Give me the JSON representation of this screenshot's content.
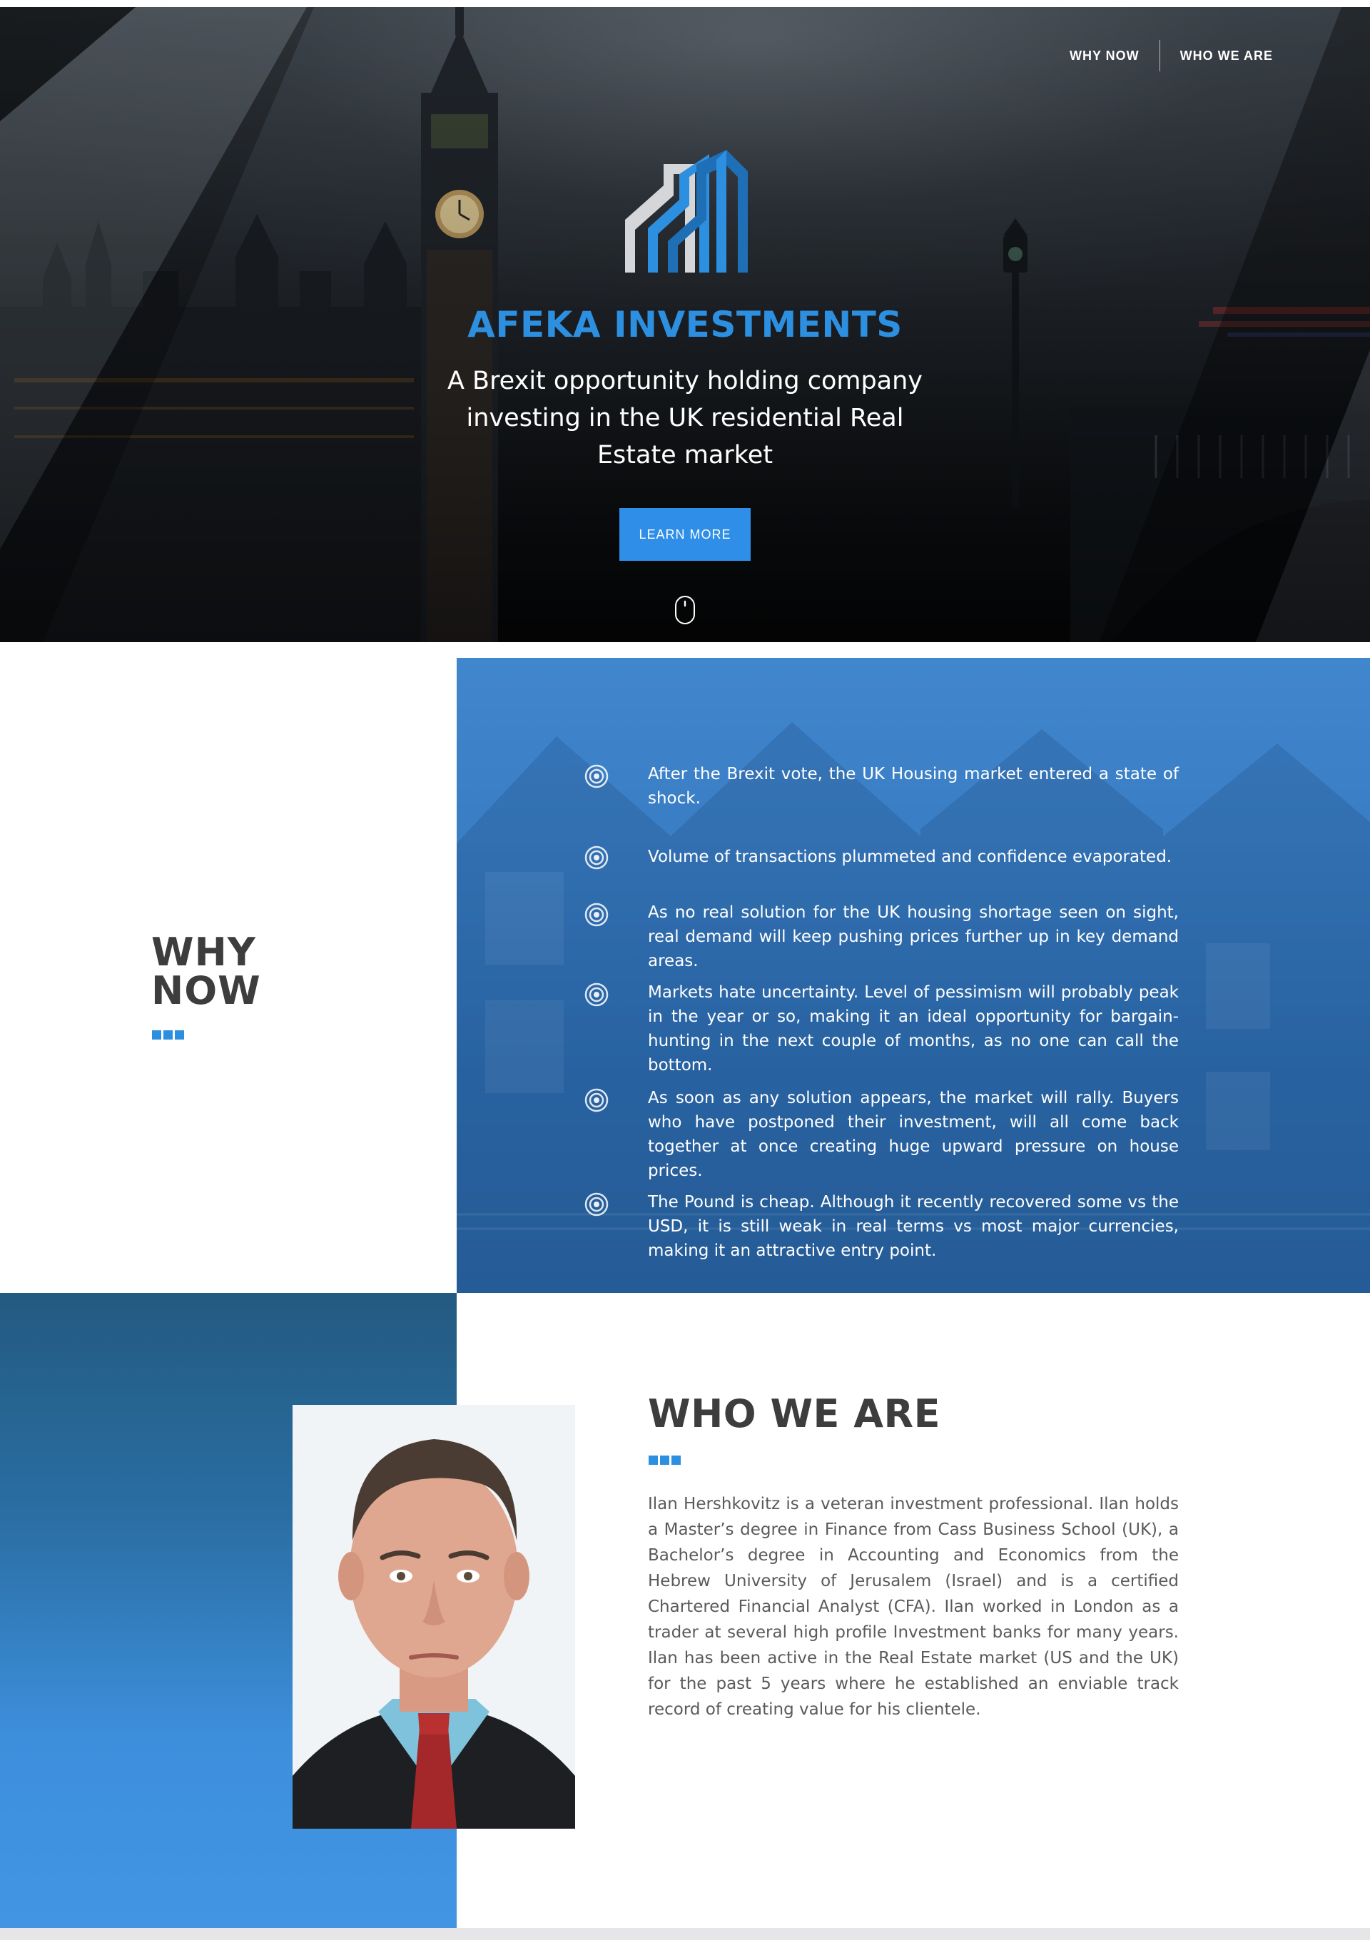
{
  "colors": {
    "accent_blue": "#2d8fe0",
    "button_blue": "#2e8ee8",
    "heading_dark": "#3d3d3d",
    "body_gray": "#5a5a5a",
    "why_panel_blue": "#3f86cc",
    "who_panel_blue": "#4195e3"
  },
  "nav": {
    "items": [
      {
        "label": "WHY NOW"
      },
      {
        "label": "WHO WE ARE"
      }
    ]
  },
  "hero": {
    "logo_icon": "building-bars-logo",
    "title": "AFEKA INVESTMENTS",
    "tagline": "A Brexit opportunity holding company investing in the UK residential Real Estate market",
    "cta_label": "LEARN MORE",
    "scroll_icon": "mouse-scroll-icon"
  },
  "why_now": {
    "title_line1": "WHY",
    "title_line2": "NOW",
    "bullet_icon": "target-icon",
    "items": [
      {
        "text": "After the Brexit vote, the UK Housing market entered a state of shock."
      },
      {
        "text": "Volume of transactions plummeted and confidence evaporated."
      },
      {
        "text": "As no real solution for the UK housing shortage seen on sight, real demand will keep pushing prices further up in key demand areas."
      },
      {
        "text": "Markets hate uncertainty. Level of pessimism will probably peak in the year or so, making it an ideal opportunity for bargain-hunting in the next couple of months, as no one can call the bottom."
      },
      {
        "text": "As soon as any solution appears, the market will rally. Buyers who have postponed their investment, will all come back together at once creating huge upward pressure on house prices."
      },
      {
        "text": "The Pound is cheap. Although it recently recovered some vs the USD, it is still weak in real terms vs most major currencies, making it an attractive entry point."
      }
    ]
  },
  "who_we_are": {
    "title": "WHO WE ARE",
    "bio": "Ilan Hershkovitz is a veteran investment professional. Ilan holds a Master’s degree in Finance from Cass Business School (UK), a Bachelor’s degree in Accounting and Economics from the Hebrew University of Jerusalem (Israel) and is a certified Chartered Financial Analyst (CFA). Ilan worked in London as a trader at several high profile Investment banks for many years. Ilan has been active in the Real Estate market (US and the UK) for the past 5 years where he established an enviable track record of creating value for his clientele."
  }
}
